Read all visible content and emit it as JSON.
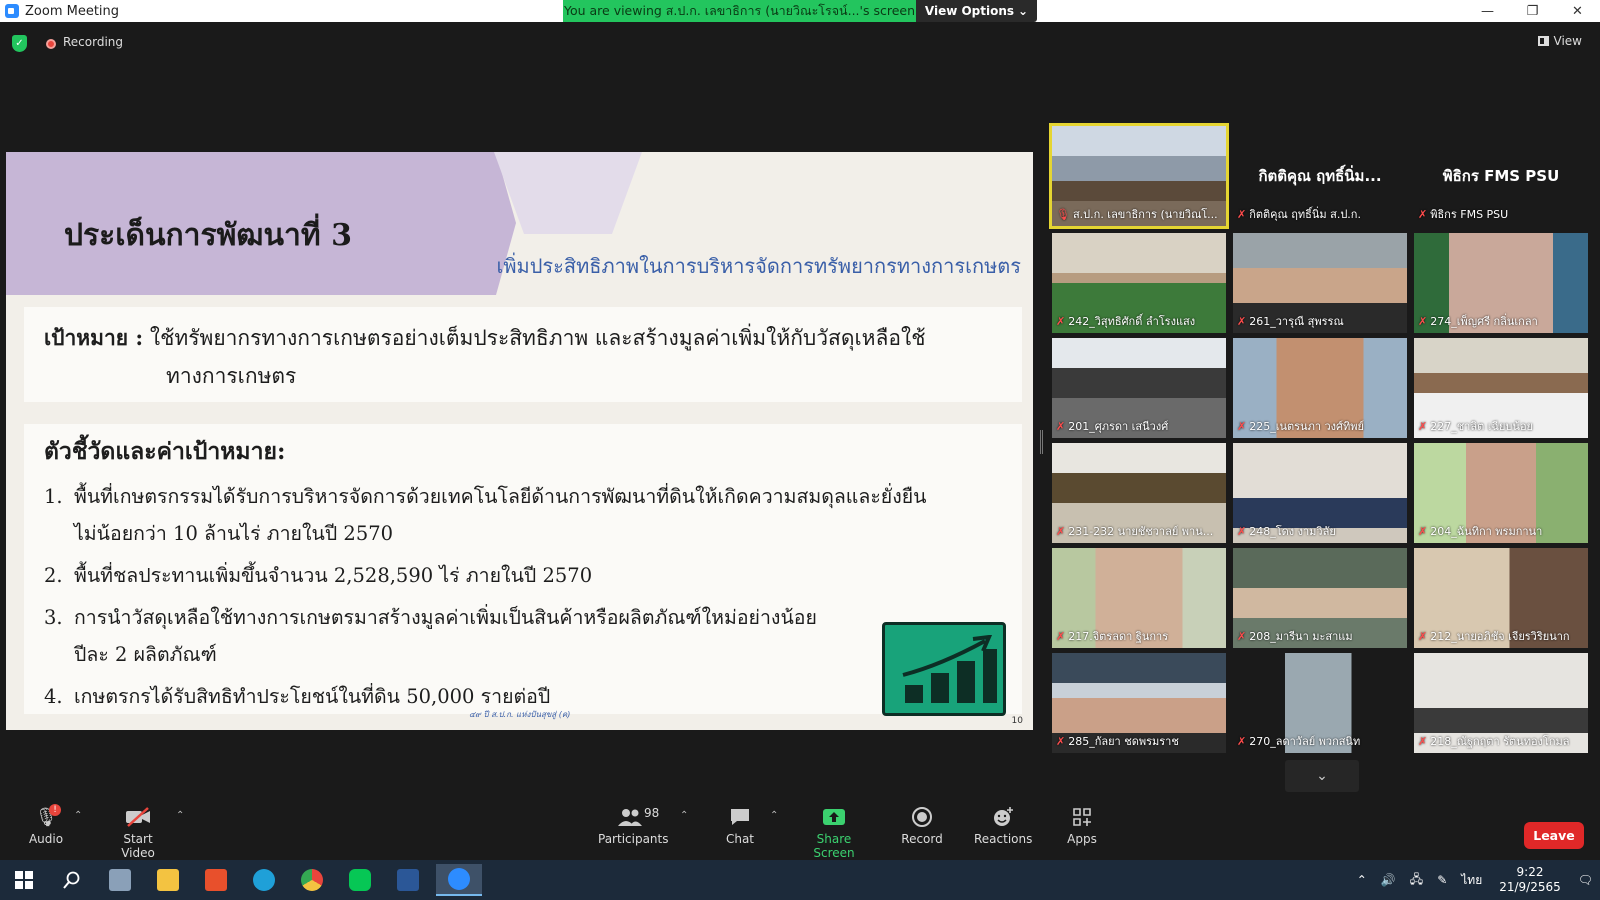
{
  "window": {
    "title": "Zoom Meeting",
    "viewing_banner": "You are viewing ส.ป.ก. เลขาธิการ (นายวิณะโรจน์...'s screen",
    "view_options": "View Options",
    "min": "—",
    "max": "❐",
    "close": "✕"
  },
  "topbar": {
    "recording": "Recording",
    "view": "View"
  },
  "slide": {
    "title": "ประเด็นการพัฒนาที่ 3",
    "subtitle": "เพิ่มประสิทธิภาพในการบริหารจัดการทรัพยากรทางการเกษตร",
    "goal_label": "เป้าหมาย :",
    "goal_line1": "ใช้ทรัพยากรทางการเกษตรอย่างเต็มประสิทธิภาพ และสร้างมูลค่าเพิ่มให้กับวัสดุเหลือใช้",
    "goal_line2": "ทางการเกษตร",
    "kpi_heading": "ตัวชี้วัดและค่าเป้าหมาย:",
    "kpis": [
      {
        "num": "1.",
        "line1": "พื้นที่เกษตรกรรมได้รับการบริหารจัดการด้วยเทคโนโลยีด้านการพัฒนาที่ดินให้เกิดความสมดุลและยั่งยืน",
        "line2": "ไม่น้อยกว่า 10 ล้านไร่ ภายในปี 2570"
      },
      {
        "num": "2.",
        "line1": "พื้นที่ชลประทานเพิ่มขึ้นจำนวน 2,528,590 ไร่ ภายในปี 2570",
        "line2": ""
      },
      {
        "num": "3.",
        "line1": "การนำวัสดุเหลือใช้ทางการเกษตรมาสร้างมูลค่าเพิ่มเป็นสินค้าหรือผลิตภัณฑ์ใหม่อย่างน้อย",
        "line2": "ปีละ 2 ผลิตภัณฑ์"
      },
      {
        "num": "4.",
        "line1": "เกษตรกรได้รับสิทธิทำประโยชน์ในที่ดิน 50,000 รายต่อปี",
        "line2": ""
      }
    ],
    "footer_logo": "๔๙ ปี ส.ป.ก. แห่งปันสุขสู่ (ค)",
    "page": "10"
  },
  "participants": [
    {
      "name": "ส.ป.ก. เลขาธิการ (นายวิณโ...",
      "scene": "office",
      "active": true
    },
    {
      "name": "กิตติคุณ ฤทธิ์นิ่ม ส.ป.ก.",
      "center": "กิตติคุณ ฤทธิ์นิ่ม...",
      "scene": "black"
    },
    {
      "name": "พิธิกร FMS PSU",
      "center": "พิธิกร FMS PSU",
      "scene": "black"
    },
    {
      "name": "242_วิสุทธิศักดิ์ ลำโรงแสง",
      "scene": "man-mask-green"
    },
    {
      "name": "261_วารุณี สุพรรณ",
      "scene": "woman-office"
    },
    {
      "name": "274_เพ็ญศรี กลิ่นเกลา",
      "scene": "woman-mask-green"
    },
    {
      "name": "201_ศุภรดา เสนีวงศ์",
      "scene": "woman-glasses"
    },
    {
      "name": "225_เนตรนภา วงศ์ทิพย์",
      "scene": "woman-mask-curtain"
    },
    {
      "name": "227_ชาลิต เฉียบน้อย",
      "scene": "man-mask-glasses"
    },
    {
      "name": "231-232 นายชัชวาลย์ พาน...",
      "scene": "office-shelves"
    },
    {
      "name": "248_โดง งามวิลัย",
      "scene": "man-far"
    },
    {
      "name": "204_ฉันทิกา พรมกานา",
      "scene": "woman-plants"
    },
    {
      "name": "217.จิตรลดา ฐินการ",
      "scene": "woman-plants2"
    },
    {
      "name": "208_มารีนา มะสาแม",
      "scene": "woman-hijab"
    },
    {
      "name": "212_นายอภิชัจ เจียรวิริยนาก",
      "scene": "man-mask-shelf"
    },
    {
      "name": "285_กัลยา ชดพรมราช",
      "scene": "woman-desk"
    },
    {
      "name": "270_ลดาวัลย์ พวกสนิท",
      "scene": "room-small"
    },
    {
      "name": "218_ณัฐกฤตา รัตนทองโกมล",
      "scene": "woman-far"
    }
  ],
  "toolbar": {
    "audio": "Audio",
    "audio_badge": "!",
    "start_video": "Start Video",
    "participants": "Participants",
    "participants_count": "98",
    "chat": "Chat",
    "share_screen": "Share Screen",
    "record": "Record",
    "reactions": "Reactions",
    "apps": "Apps",
    "leave": "Leave"
  },
  "taskbar": {
    "lang": "ไทย",
    "time": "9:22",
    "date": "21/9/2565"
  },
  "colors": {
    "accent_green": "#23c55e",
    "leave_red": "#e02828",
    "active_speaker": "#e5d532",
    "slide_purple": "#c6b6d6",
    "subtitle_blue": "#3a5fa8"
  }
}
